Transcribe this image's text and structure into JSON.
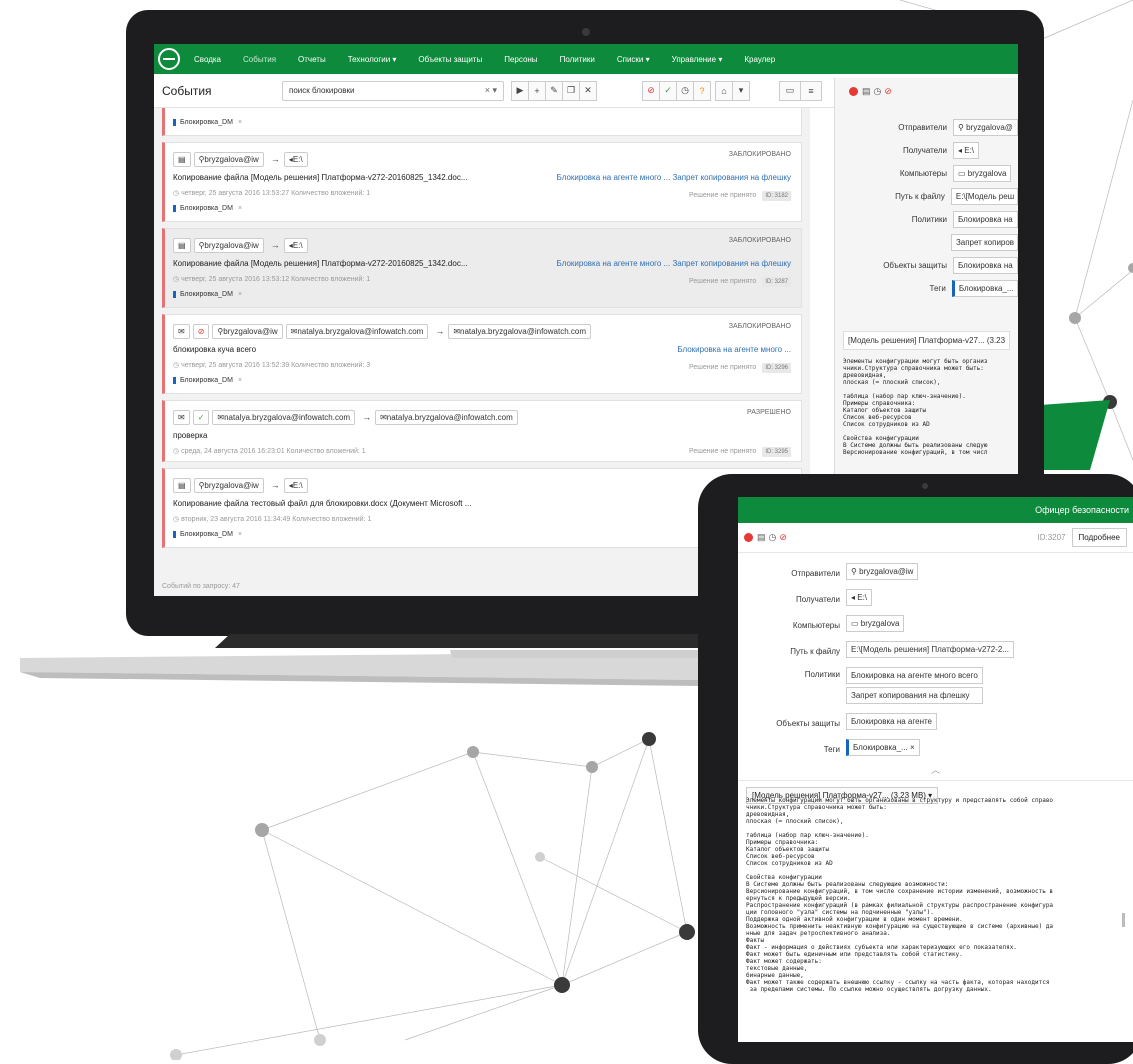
{
  "nav": {
    "items": [
      "Сводка",
      "События",
      "Отчеты",
      "Технологии ▾",
      "Объекты защиты",
      "Персоны",
      "Политики",
      "Списки ▾",
      "Управление ▾",
      "Краулер"
    ]
  },
  "toolbar": {
    "title": "События",
    "search_value": "поиск блокировки",
    "search_clear": "×  ▾"
  },
  "events": [
    {
      "sender": "bryzgalova@iw",
      "recipient": "E:\\",
      "status": "ЗАБЛОКИРОВАНО",
      "title": "Копирование файла [Модель решения] Платформа-v272-20160825_1342.doc...",
      "policies": "Блокировка на агенте много ...   Запрет копирования на флешку",
      "meta": "четверг, 25 августа 2016 13:53:27    Количество вложений: 1",
      "decision": "Решение не принято",
      "id": "ID: 3182",
      "tag": "Блокировка_DM"
    },
    {
      "sender": "bryzgalova@iw",
      "recipient": "E:\\",
      "status": "ЗАБЛОКИРОВАНО",
      "title": "Копирование файла [Модель решения] Платформа-v272-20160825_1342.doc...",
      "policies": "Блокировка на агенте много ...   Запрет копирования на флешку",
      "meta": "четверг, 25 августа 2016 13:53:12    Количество вложений: 1",
      "decision": "Решение не принято",
      "id": "ID: 3287",
      "tag": "Блокировка_DM"
    },
    {
      "sender": "bryzgalova@iw",
      "sender2": "natalya.bryzgalova@infowatch.com",
      "recipient": "natalya.bryzgalova@infowatch.com",
      "status": "ЗАБЛОКИРОВАНО",
      "title": "блокировка куча всего",
      "policies": "Блокировка на агенте много ...",
      "meta": "четверг, 25 августа 2016 13:52:39    Количество вложений: 3",
      "decision": "Решение не принято",
      "id": "ID: 3296",
      "tag": "Блокировка_DM"
    },
    {
      "sender": "natalya.bryzgalova@infowatch.com",
      "recipient": "natalya.bryzgalova@infowatch.com",
      "status": "РАЗРЕШЕНО",
      "title": "проверка",
      "meta": "среда, 24 августа 2016 16:23:01    Количество вложений: 1",
      "decision": "Решение не принято",
      "id": "ID: 3295"
    },
    {
      "sender": "bryzgalova@iw",
      "recipient": "E:\\",
      "title": "Копирование файла тестовый файл для блокировки.docx (Документ Microsoft ...",
      "meta": "вторник, 23 августа 2016 11:34:49    Количество вложений: 1",
      "tag": "Блокировка_DM"
    }
  ],
  "top_tag": "Блокировка_DM",
  "footer": "Событий по запросу: 47",
  "panel": {
    "rows": [
      {
        "label": "Отправители",
        "value": "bryzgalova@"
      },
      {
        "label": "Получатели",
        "value": "E:\\"
      },
      {
        "label": "Компьютеры",
        "value": "bryzgalova"
      },
      {
        "label": "Путь к файлу",
        "value": "E:\\[Модель реш"
      },
      {
        "label": "Политики",
        "value": "Блокировка на"
      },
      {
        "label": "",
        "value": "Запрет копиров"
      },
      {
        "label": "Объекты защиты",
        "value": "Блокировка на"
      },
      {
        "label": "Теги",
        "value": "Блокировка_..."
      }
    ],
    "file": "[Модель решения] Платформа-v27... (3.23",
    "text": "Элементы конфигурации могут быть организ\nчники.Структура справочника может быть:\nдревовидная,\nплоская (= плоский список),\n\nтаблица (набор пар ключ-значение).\nПримеры справочника:\nКаталог объектов защиты\nСписок веб-ресурсов\nСписок сотрудников из AD\n\nСвойства конфигурации\nВ Системе должны быть реализованы следую\nВерсионирование конфигураций, в том числ"
  },
  "tablet": {
    "role": "Офицер безопасности",
    "id": "ID:3207",
    "more_button": "Подробнее",
    "rows": [
      {
        "label": "Отправители",
        "values": [
          "bryzgalova@iw"
        ]
      },
      {
        "label": "Получатели",
        "values": [
          "E:\\"
        ]
      },
      {
        "label": "Компьютеры",
        "values": [
          "bryzgalova"
        ]
      },
      {
        "label": "Путь к файлу",
        "values": [
          "E:\\[Модель решения] Платформа-v272-2..."
        ]
      },
      {
        "label": "Политики",
        "values": [
          "Блокировка на агенте много всего",
          "Запрет копирования на флешку"
        ]
      },
      {
        "label": "Объекты защиты",
        "values": [
          "Блокировка на агенте"
        ]
      },
      {
        "label": "Теги",
        "values": [
          "Блокировка_...  ×"
        ]
      }
    ],
    "file": "[Модель решения] Платформа-v27... (3.23 MB) ▾",
    "text": "Элементы конфигурации могут быть организованы в структуру и представлять собой справо\nчники.Структура справочника может быть:\nдревовидная,\nплоская (= плоский список),\n\nтаблица (набор пар ключ-значение).\nПримеры справочника:\nКаталог объектов защиты\nСписок веб-ресурсов\nСписок сотрудников из AD\n\nСвойства конфигурации\nВ Системе должны быть реализованы следующие возможности:\nВерсионирование конфигураций, в том числе сохранение истории изменений, возможность в\nернуться к предыдущей версии.\nРаспространение конфигураций (в рамках филиальной структуры распространение конфигура\nции головного \"узла\" системы на подчиненные \"узлы\").\nПоддержка одной активной конфигурации в один момент времени.\nВозможность применить неактивную конфигурацию на существующие в системе (архивные) да\nнные для задач ретроспективного анализа.\nФакты\nФакт - информация о действиях субъекта или характеризующих его показателях.\nФакт может быть единичным или представлять собой статистику.\nФакт может содержать:\nтекстовые данные,\nбинарные данные,\nФакт может также содержать внешнюю ссылку - ссылку на часть факта, которая находится\n за пределами системы. По ссылке можно осуществлять догрузку данных."
  }
}
